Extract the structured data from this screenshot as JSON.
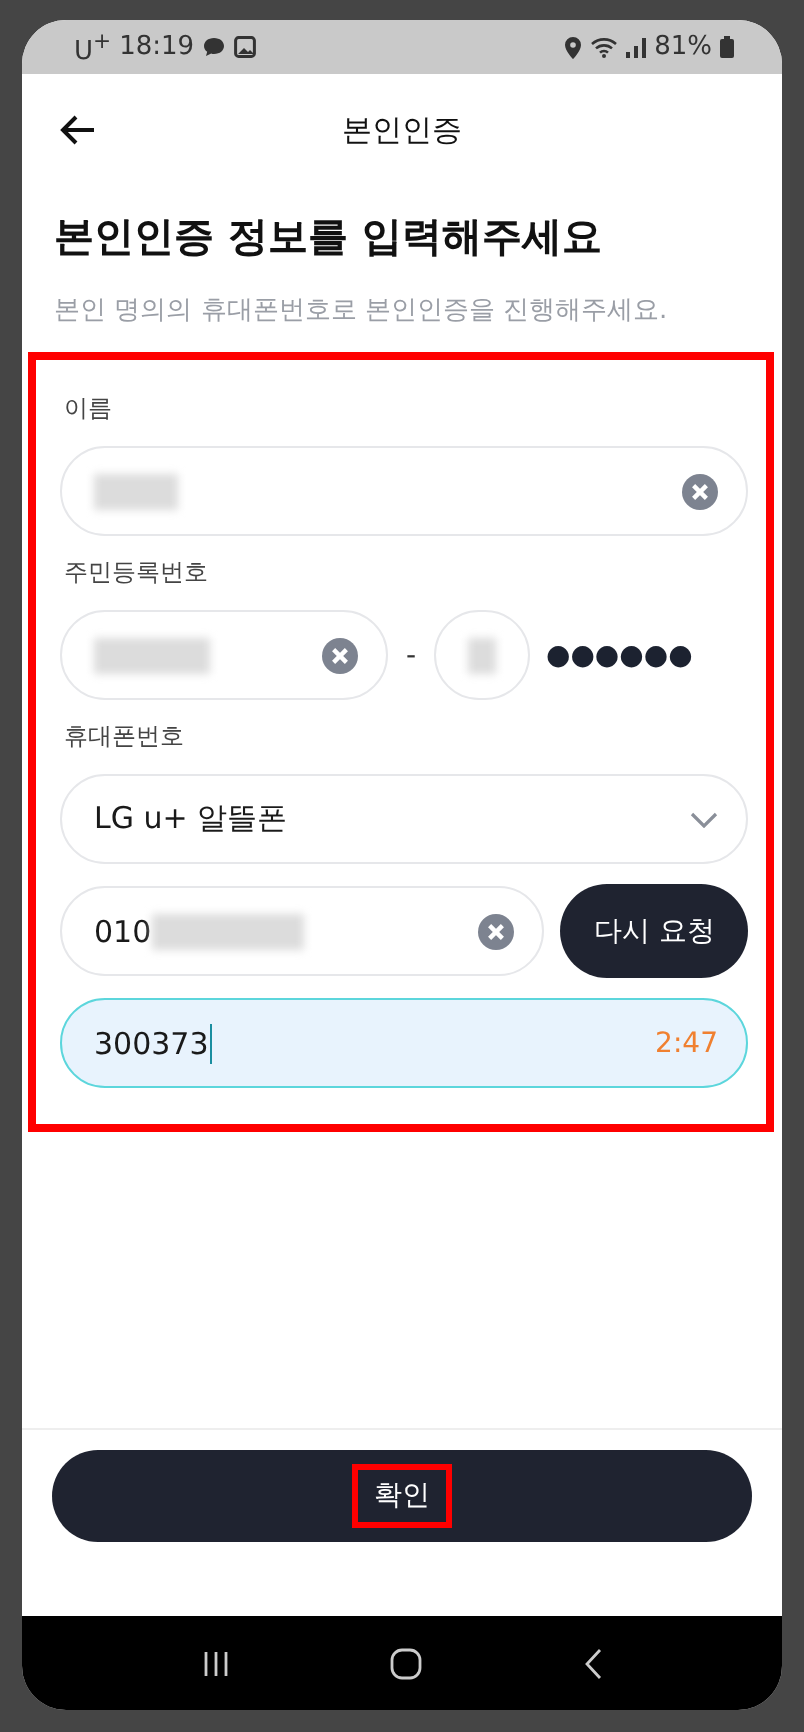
{
  "status_bar": {
    "carrier": "U$^{+}$",
    "time": "18:19",
    "battery": "81%"
  },
  "header": {
    "title": "본인인증"
  },
  "heading": "본인인증 정보를 입력해주세요",
  "subtitle": "본인 명의의 휴대폰번호로 본인인증을 진행해주세요.",
  "form": {
    "highlighted": true,
    "name": {
      "label": "이름"
    },
    "resident": {
      "label": "주민등록번호",
      "separator": "-",
      "masked": "●●●●●●"
    },
    "phone": {
      "label": "휴대폰번호",
      "carrier": "LG u+ 알뜰폰",
      "number_prefix": "010",
      "resend_button": "다시 요청"
    },
    "code": {
      "value": "300373",
      "timer": "2:47",
      "focused": true
    }
  },
  "confirm": {
    "label": "확인",
    "highlighted": true
  }
}
